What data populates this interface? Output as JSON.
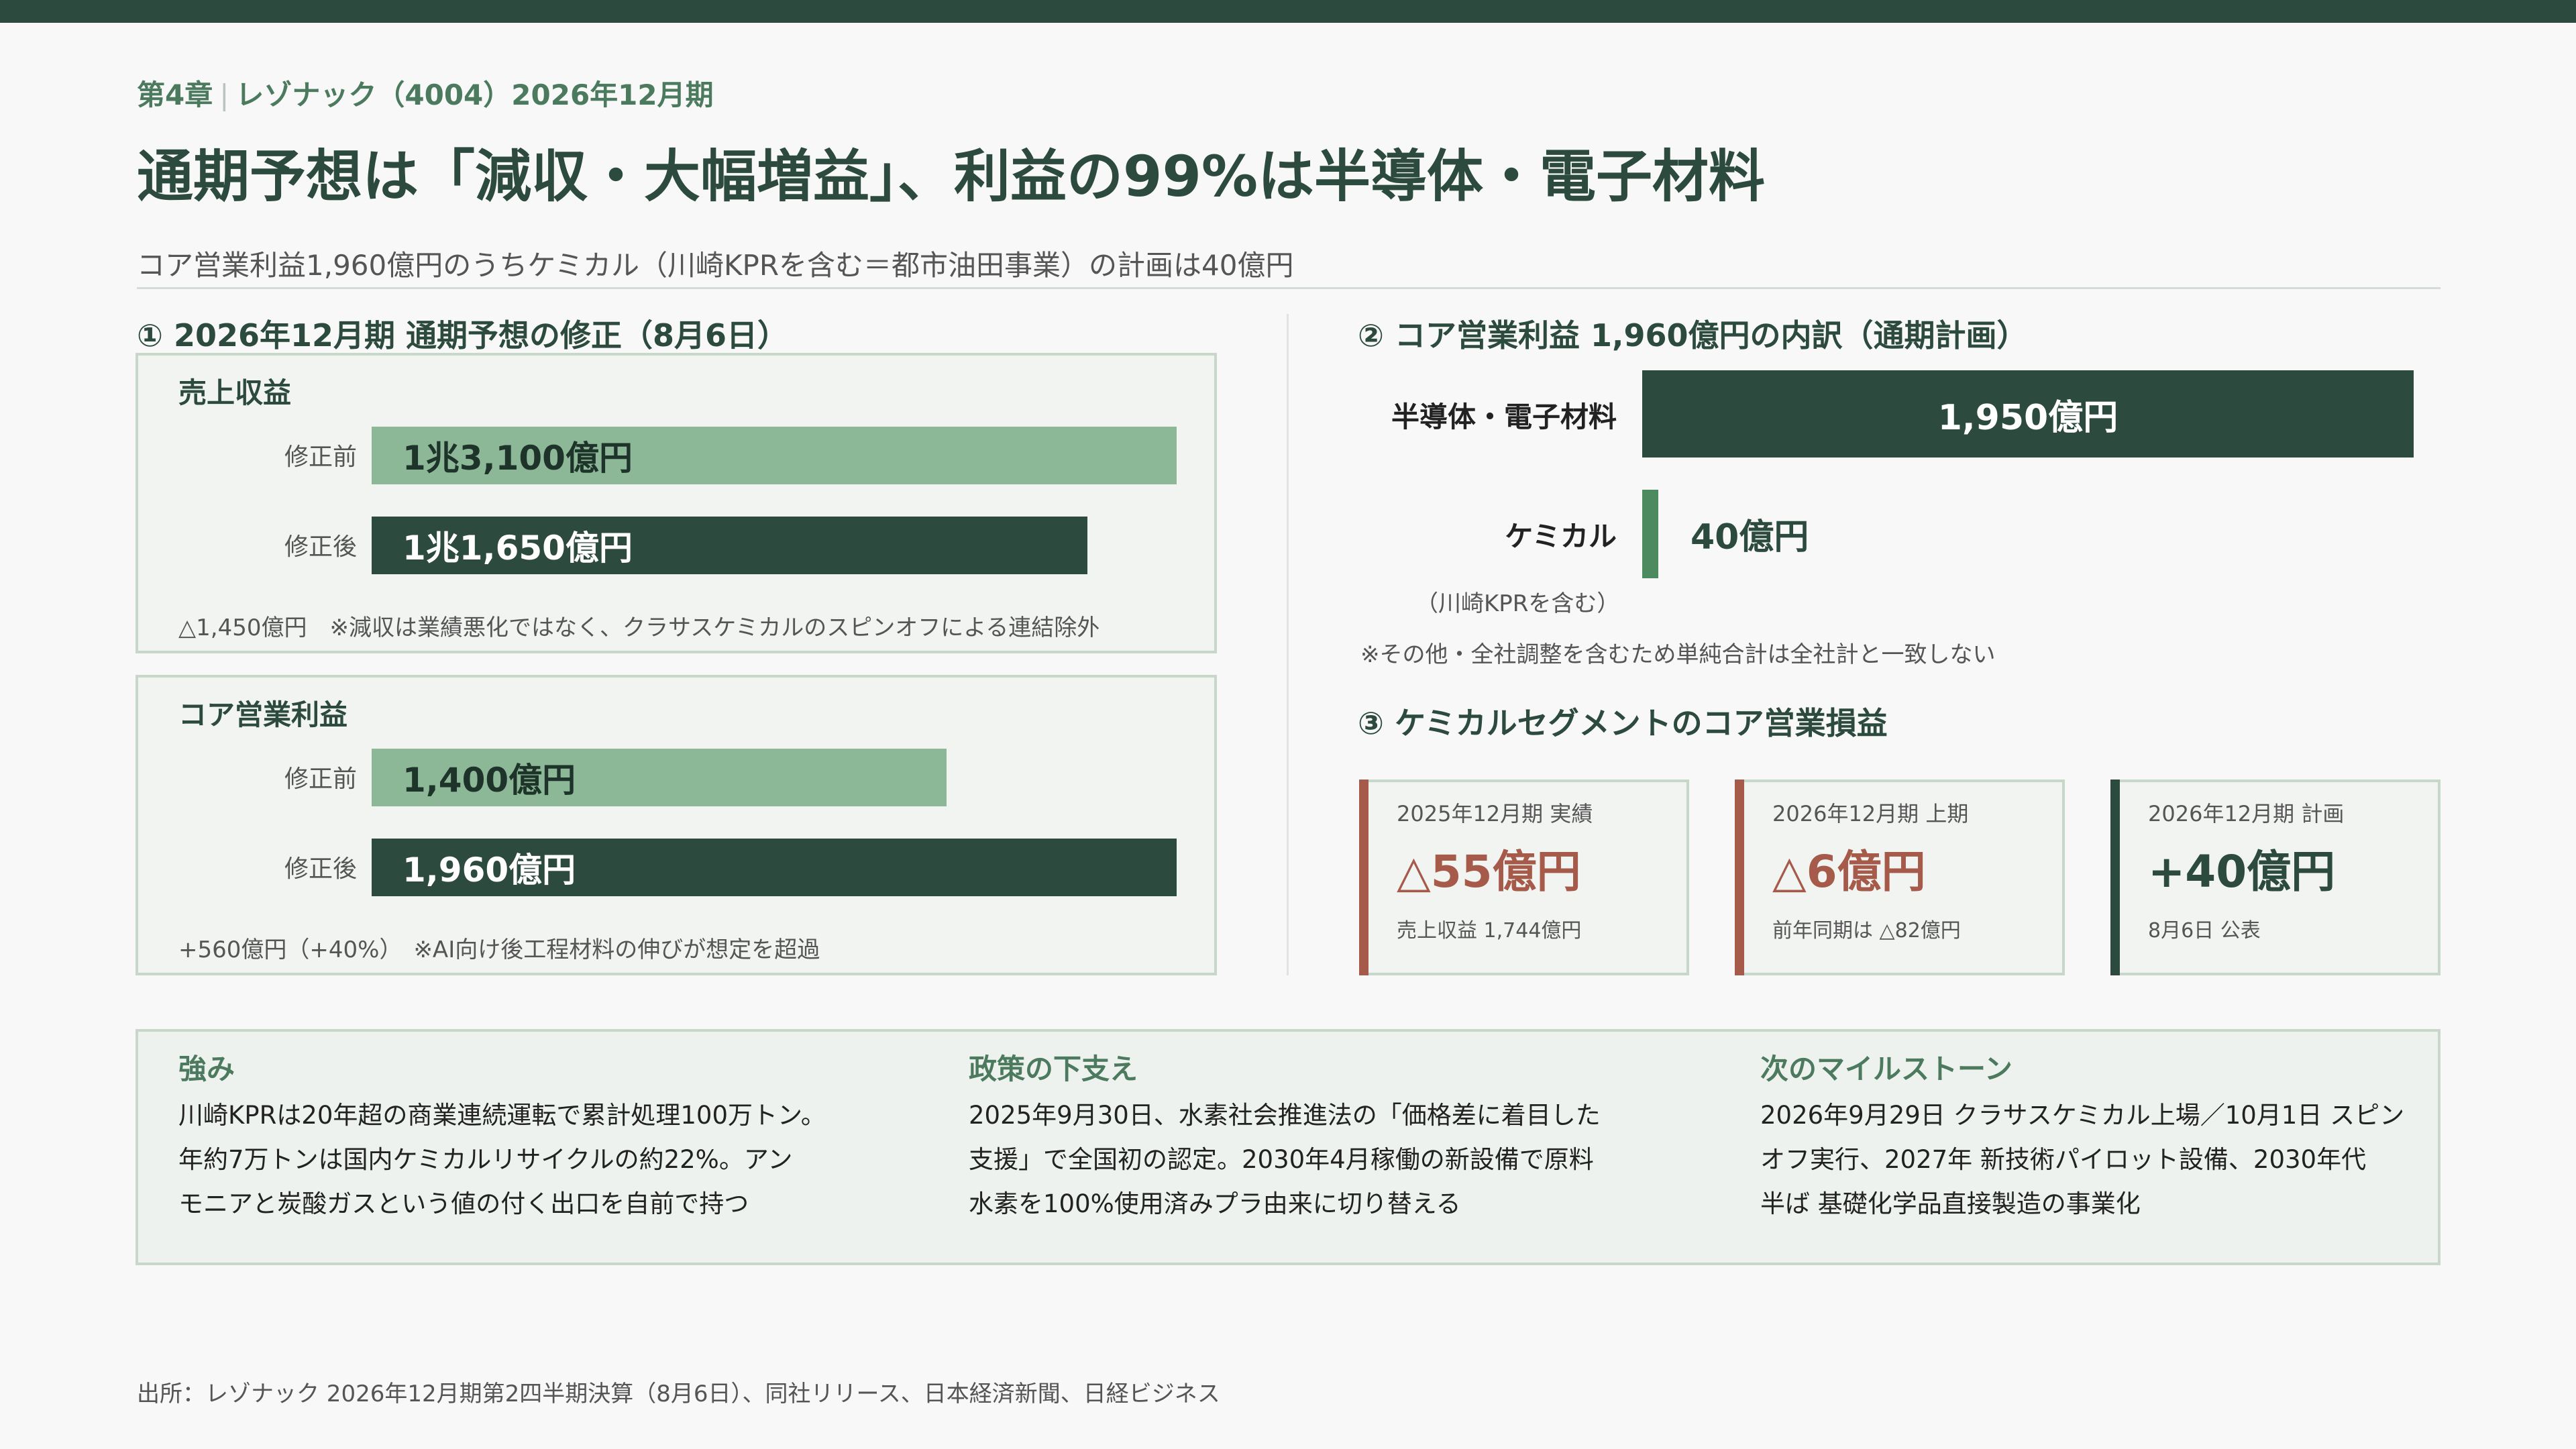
{
  "header": {
    "chapter": "第4章",
    "company": "レゾナック（4004）2026年12月期",
    "title": "通期予想は「減収・大幅増益」、利益の99%は半導体・電子材料",
    "subtitle": "コア営業利益1,960億円のうちケミカル（川崎KPRを含む＝都市油田事業）の計画は40億円"
  },
  "section1": {
    "heading": "①  2026年12月期 通期予想の修正（8月6日）",
    "revenue": {
      "title": "売上収益",
      "before_label": "修正前",
      "after_label": "修正後",
      "before_text": "1兆3,100億円",
      "after_text": "1兆1,650億円",
      "note": "△1,450億円　※減収は業績悪化ではなく、クラサスケミカルのスピンオフによる連結除外"
    },
    "profit": {
      "title": "コア営業利益",
      "before_label": "修正前",
      "after_label": "修正後",
      "before_text": "1,400億円",
      "after_text": "1,960億円",
      "note": "+560億円（+40%）　※AI向け後工程材料の伸びが想定を超過"
    }
  },
  "section2": {
    "heading": "②  コア営業利益 1,960億円の内訳（通期計画）",
    "semi_label": "半導体・電子材料",
    "semi_value": "1,950億円",
    "chem_label": "ケミカル",
    "chem_sub": "（川崎KPRを含む）",
    "chem_value": "40億円",
    "note": "※その他・全社調整を含むため単純合計は全社計と一致しない"
  },
  "section3": {
    "heading": "③  ケミカルセグメントのコア営業損益",
    "cards": [
      {
        "label": "2025年12月期 実績",
        "value": "△55億円",
        "sub": "売上収益 1,744億円"
      },
      {
        "label": "2026年12月期 上期",
        "value": "△6億円",
        "sub": "前年同期は △82億円"
      },
      {
        "label": "2026年12月期 計画",
        "value": "+40億円",
        "sub": "8月6日 公表"
      }
    ]
  },
  "bottom": [
    {
      "heading": "強み",
      "lines": [
        "川崎KPRは20年超の商業連続運転で累計処理100万トン。",
        "年約7万トンは国内ケミカルリサイクルの約22%。アン",
        "モニアと炭酸ガスという値の付く出口を自前で持つ"
      ]
    },
    {
      "heading": "政策の下支え",
      "lines": [
        "2025年9月30日、水素社会推進法の「価格差に着目した",
        "支援」で全国初の認定。2030年4月稼働の新設備で原料",
        "水素を100%使用済みプラ由来に切り替える"
      ]
    },
    {
      "heading": "次のマイルストーン",
      "lines": [
        "2026年9月29日 クラサスケミカル上場／10月1日 スピン",
        "オフ実行、2027年 新技術パイロット設備、2030年代",
        "半ば 基礎化学品直接製造の事業化"
      ]
    }
  ],
  "source": "出所：レゾナック 2026年12月期第2四半期決算（8月6日）、同社リリース、日本経済新聞、日経ビジネス",
  "colors": {
    "dark_green": "#2c4a3d",
    "light_green": "#8db898",
    "accent_green": "#4e8a5f",
    "loss_red": "#a65a4a"
  },
  "chart_data": [
    {
      "type": "bar",
      "title": "売上収益",
      "categories": [
        "修正前",
        "修正後"
      ],
      "values": [
        13100,
        11650
      ],
      "unit": "億円"
    },
    {
      "type": "bar",
      "title": "コア営業利益",
      "categories": [
        "修正前",
        "修正後"
      ],
      "values": [
        1400,
        1960
      ],
      "unit": "億円"
    },
    {
      "type": "bar",
      "title": "コア営業利益 1,960億円の内訳（通期計画）",
      "categories": [
        "半導体・電子材料",
        "ケミカル"
      ],
      "values": [
        1950,
        40
      ],
      "unit": "億円"
    },
    {
      "type": "table",
      "title": "ケミカルセグメントのコア営業損益",
      "categories": [
        "2025年12月期 実績",
        "2026年12月期 上期",
        "2026年12月期 計画"
      ],
      "values": [
        -55,
        -6,
        40
      ],
      "unit": "億円"
    }
  ]
}
